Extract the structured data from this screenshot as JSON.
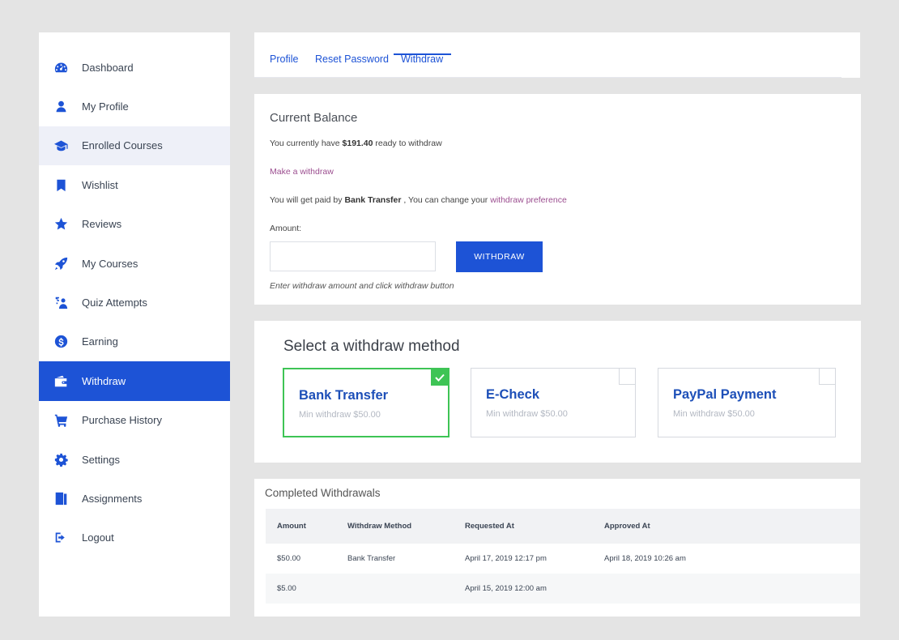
{
  "sidebar": {
    "items": [
      {
        "label": "Dashboard",
        "icon": "dashboard-icon"
      },
      {
        "label": "My Profile",
        "icon": "user-icon"
      },
      {
        "label": "Enrolled Courses",
        "icon": "graduation-cap-icon"
      },
      {
        "label": "Wishlist",
        "icon": "bookmark-icon"
      },
      {
        "label": "Reviews",
        "icon": "star-icon"
      },
      {
        "label": "My Courses",
        "icon": "rocket-icon"
      },
      {
        "label": "Quiz Attempts",
        "icon": "quiz-icon"
      },
      {
        "label": "Earning",
        "icon": "dollar-coin-icon"
      },
      {
        "label": "Withdraw",
        "icon": "wallet-icon"
      },
      {
        "label": "Purchase History",
        "icon": "cart-icon"
      },
      {
        "label": "Settings",
        "icon": "gear-icon"
      },
      {
        "label": "Assignments",
        "icon": "assignment-icon"
      },
      {
        "label": "Logout",
        "icon": "logout-icon"
      }
    ],
    "active": "Withdraw",
    "hovered": "Enrolled Courses"
  },
  "tabs": {
    "profile": "Profile",
    "reset_password": "Reset Password",
    "withdraw": "Withdraw",
    "active": "Withdraw"
  },
  "balance": {
    "title": "Current Balance",
    "prefix": "You currently have",
    "amount": "$191.40",
    "suffix": "ready to withdraw",
    "make_withdraw": "Make a withdraw",
    "paid_prefix": "You will get paid by",
    "paid_method": "Bank Transfer",
    "paid_middle": ", You can change your",
    "preference_link": "withdraw preference",
    "amount_label": "Amount:",
    "amount_value": "",
    "withdraw_button": "WITHDRAW",
    "hint": "Enter withdraw amount and click withdraw button"
  },
  "methods": {
    "title": "Select a withdraw method",
    "options": [
      {
        "name": "Bank Transfer",
        "min": "Min withdraw $50.00",
        "selected": true
      },
      {
        "name": "E-Check",
        "min": "Min withdraw $50.00",
        "selected": false
      },
      {
        "name": "PayPal Payment",
        "min": "Min withdraw $50.00",
        "selected": false
      }
    ]
  },
  "completed": {
    "title": "Completed Withdrawals",
    "headers": [
      "Amount",
      "Withdraw Method",
      "Requested At",
      "Approved At"
    ],
    "rows": [
      [
        "$50.00",
        "Bank Transfer",
        "April 17, 2019 12:17 pm",
        "April 18, 2019 10:26 am"
      ],
      [
        "$5.00",
        "",
        "April 15, 2019 12:00 am",
        ""
      ]
    ]
  },
  "colors": {
    "accent": "#1d53d6",
    "link": "#9b4d8f",
    "selected_border": "#3ec455",
    "background": "#e4e4e4"
  }
}
